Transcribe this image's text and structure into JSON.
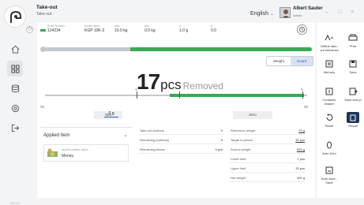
{
  "header": {
    "title": "Take-out",
    "subtitle": "Take-out",
    "language": "English",
    "user_name": "Albert Sauter",
    "user_role": "Admin",
    "window_controls": [
      "–",
      "□",
      "×"
    ]
  },
  "info": {
    "labels": [
      "Scale Number",
      "Model name",
      "Max",
      "Min",
      "d",
      "e"
    ],
    "values": [
      "124234",
      "KGP 10K-3",
      "10.0 kg",
      "0.0 kg",
      "1.0 g",
      "0.0"
    ]
  },
  "progress": {
    "fraction": 0.67
  },
  "view_toggle": {
    "options": [
      "Weight",
      "Count"
    ],
    "selected": "Count"
  },
  "reading": {
    "value": "17",
    "unit": "pcs",
    "status": "Removed"
  },
  "scale_markers": {
    "left": "+",
    "right": "+",
    "tolerance_marker": "×"
  },
  "buttons": {
    "tare": "Tare",
    "tare_value": "0",
    "tare_unit": "g",
    "zero": "Zero"
  },
  "applied": {
    "title": "Applied Item",
    "item_type": "Applied master object",
    "item_name": "Money"
  },
  "left_table": [
    {
      "label": "Take-out portions",
      "value": "0"
    },
    {
      "label": "Remaining portion(s)",
      "value": "9"
    },
    {
      "label": "Remaining pieces",
      "value": "9 pcs"
    }
  ],
  "right_table": [
    {
      "label": "Reference weight",
      "value": "23 g"
    },
    {
      "label": "Target in pieces",
      "value": "30 pcs"
    },
    {
      "label": "Source weight",
      "value": "826 g"
    },
    {
      "label": "Lower limit",
      "value": "1 pcs"
    },
    {
      "label": "Upper limit",
      "value": "33 pcs"
    },
    {
      "label": "Net weight",
      "value": "391 g"
    }
  ],
  "tools": [
    {
      "label": "Define take-\nout reference",
      "icon": "define-reference-icon"
    },
    {
      "label": "Print",
      "icon": "print-icon"
    },
    {
      "label": "Memory",
      "icon": "memory-icon"
    },
    {
      "label": "Save",
      "icon": "save-icon"
    },
    {
      "label": "Container\nmaster",
      "icon": "container-icon"
    },
    {
      "label": "Save and pr",
      "icon": "save-print-icon"
    },
    {
      "label": "Reset",
      "icon": "reset-icon"
    },
    {
      "label": "Result",
      "icon": "result-icon"
    },
    {
      "label": "Auto Zero",
      "icon": "auto-zero-icon"
    },
    {
      "label": "Auto save -\nSave",
      "icon": "auto-save-icon"
    }
  ],
  "build_label": "V.B.3.0",
  "colors": {
    "accent_green": "#3aa856",
    "dark_blue": "#1f3558",
    "link_blue": "#2f63b6"
  }
}
